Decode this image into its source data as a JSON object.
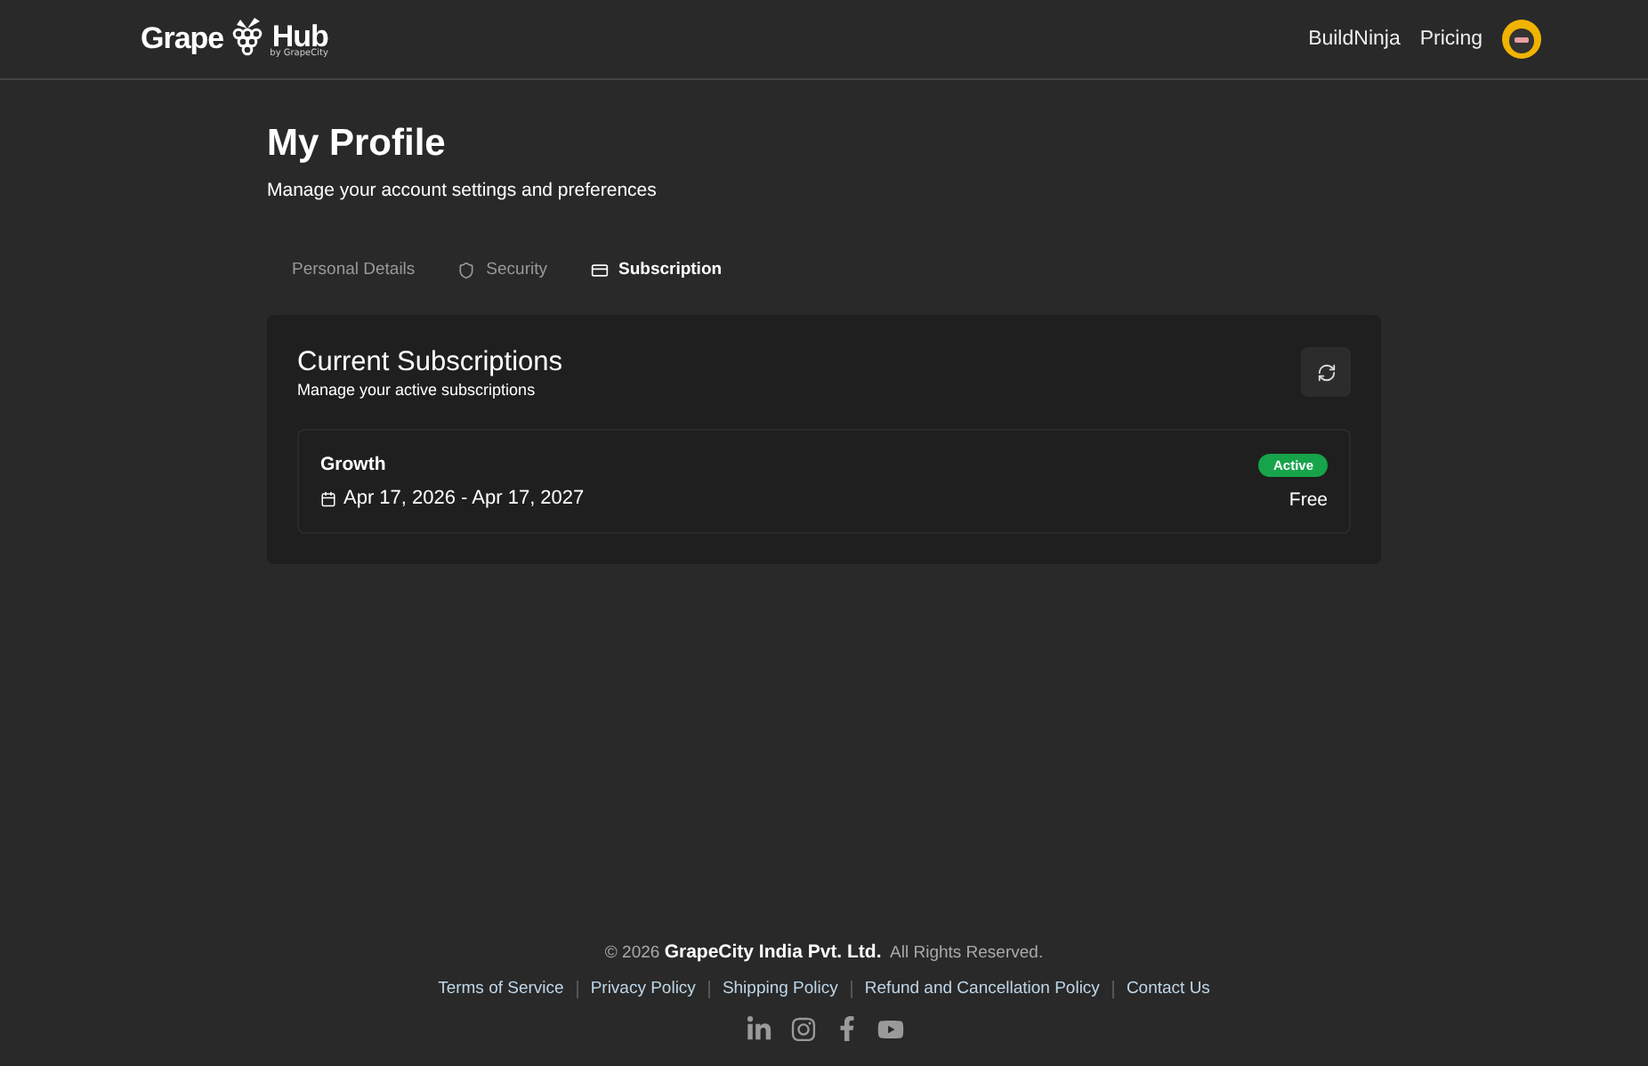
{
  "header": {
    "logo": {
      "left": "Grape",
      "right": "Hub",
      "byline": "by GrapeCity"
    },
    "nav": [
      "BuildNinja",
      "Pricing"
    ]
  },
  "page": {
    "title": "My Profile",
    "subtitle": "Manage your account settings and preferences"
  },
  "tabs": [
    {
      "label": "Personal Details",
      "kind": "plain",
      "selected": false
    },
    {
      "label": "Security",
      "kind": "shield",
      "selected": false
    },
    {
      "label": "Subscription",
      "kind": "card",
      "selected": true
    }
  ],
  "card": {
    "title": "Current Subscriptions",
    "subtitle": "Manage your active subscriptions",
    "subscriptions": [
      {
        "plan": "Growth",
        "dates": "Apr 17, 2026 - Apr 17, 2027",
        "status": "Active",
        "price": "Free"
      }
    ]
  },
  "footer": {
    "copyright": "© 2026 **GrapeCity India Pvt. Ltd.**  All Rights Reserved.",
    "links": [
      "Terms of Service",
      "Privacy Policy",
      "Shipping Policy",
      "Refund and Cancellation Policy",
      "Contact Us"
    ]
  }
}
